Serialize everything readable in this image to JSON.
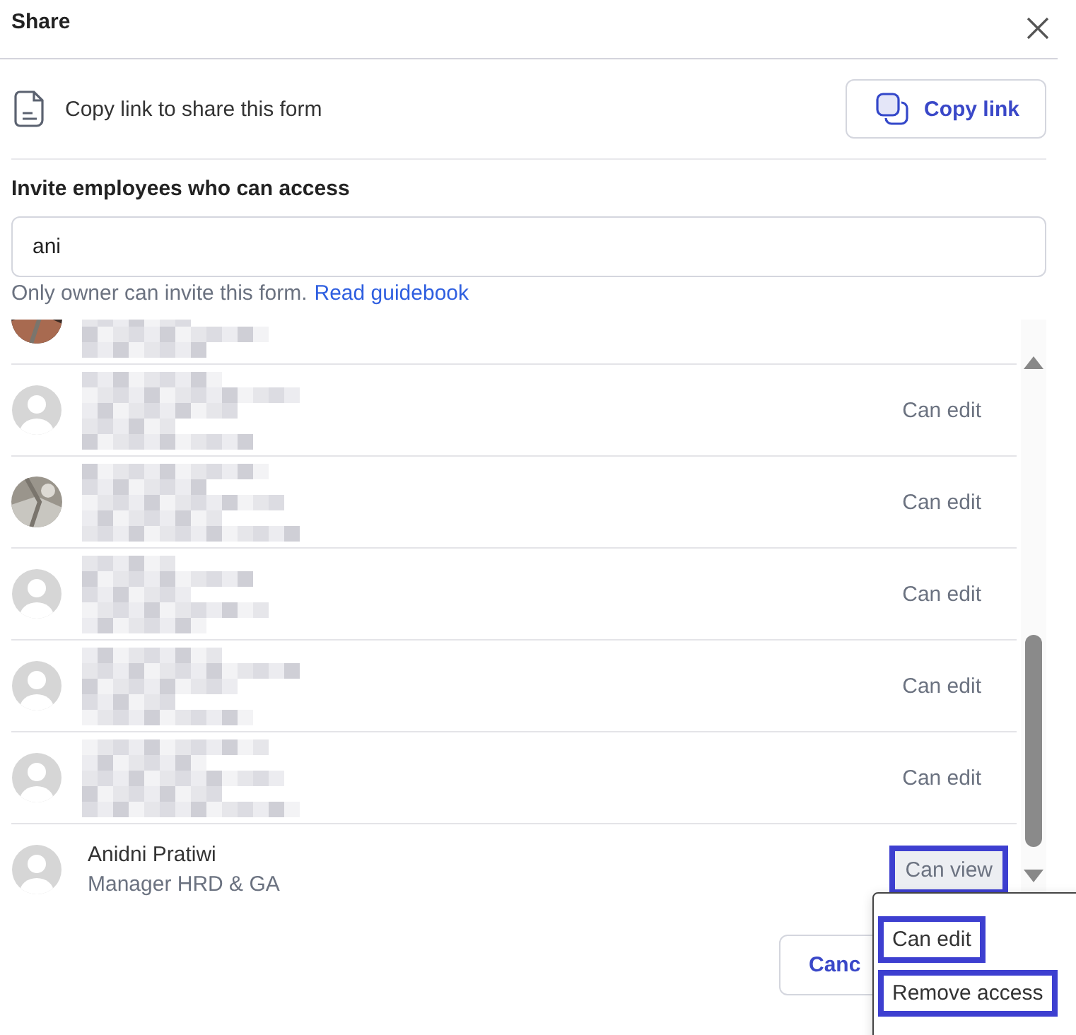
{
  "dialog": {
    "title": "Share"
  },
  "copy_link": {
    "text": "Copy link to share this form",
    "button": "Copy link"
  },
  "invite": {
    "label": "Invite employees who can access",
    "search": {
      "value": "ani"
    },
    "hint": "Only owner can invite this form.",
    "link": "Read guidebook"
  },
  "members": [
    {
      "kind": "redacted",
      "photo": true
    },
    {
      "kind": "redacted",
      "photo": false,
      "permission": "Can edit",
      "highlighted": false
    },
    {
      "kind": "redacted",
      "photo": true,
      "permission": "Can edit",
      "highlighted": false
    },
    {
      "kind": "redacted",
      "photo": false,
      "permission": "Can edit",
      "highlighted": false
    },
    {
      "kind": "redacted",
      "photo": false,
      "permission": "Can edit",
      "highlighted": false
    },
    {
      "kind": "redacted",
      "photo": false,
      "permission": "Can edit",
      "highlighted": false
    },
    {
      "kind": "named",
      "photo": false,
      "name": "Anidni Pratiwi",
      "role": "Manager HRD & GA",
      "permission": "Can view",
      "highlighted": true
    }
  ],
  "footer": {
    "cancel": "Canc"
  },
  "permission_menu": [
    {
      "label": "Can edit",
      "highlighted": true
    },
    {
      "label": "Remove access",
      "highlighted": true
    }
  ]
}
